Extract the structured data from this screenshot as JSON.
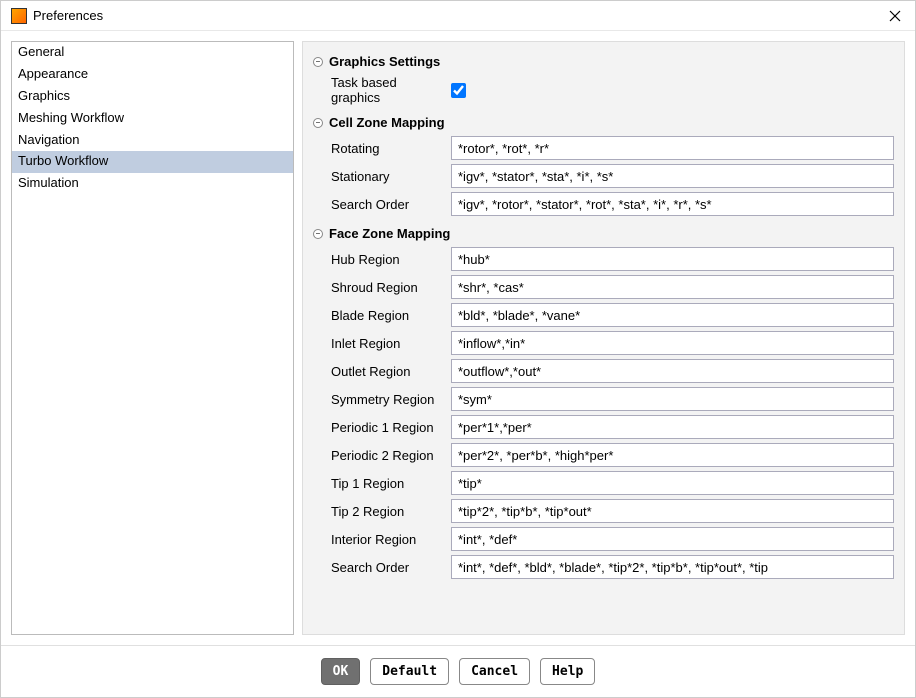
{
  "window": {
    "title": "Preferences"
  },
  "sidebar": {
    "items": [
      {
        "label": "General",
        "selected": false
      },
      {
        "label": "Appearance",
        "selected": false
      },
      {
        "label": "Graphics",
        "selected": false
      },
      {
        "label": "Meshing Workflow",
        "selected": false
      },
      {
        "label": "Navigation",
        "selected": false
      },
      {
        "label": "Turbo Workflow",
        "selected": true
      },
      {
        "label": "Simulation",
        "selected": false
      }
    ]
  },
  "sections": {
    "graphics": {
      "title": "Graphics Settings",
      "task_based_label": "Task based graphics",
      "task_based_checked": true
    },
    "cell_zone": {
      "title": "Cell Zone Mapping",
      "rotating_label": "Rotating",
      "rotating_value": "*rotor*, *rot*, *r*",
      "stationary_label": "Stationary",
      "stationary_value": "*igv*, *stator*, *sta*, *i*, *s*",
      "search_order_label": "Search Order",
      "search_order_value": "*igv*, *rotor*, *stator*, *rot*, *sta*, *i*, *r*, *s*"
    },
    "face_zone": {
      "title": "Face Zone Mapping",
      "hub_label": "Hub Region",
      "hub_value": "*hub*",
      "shroud_label": "Shroud Region",
      "shroud_value": "*shr*, *cas*",
      "blade_label": "Blade Region",
      "blade_value": "*bld*, *blade*, *vane*",
      "inlet_label": "Inlet Region",
      "inlet_value": "*inflow*,*in*",
      "outlet_label": "Outlet Region",
      "outlet_value": "*outflow*,*out*",
      "symmetry_label": "Symmetry Region",
      "symmetry_value": "*sym*",
      "periodic1_label": "Periodic 1 Region",
      "periodic1_value": "*per*1*,*per*",
      "periodic2_label": "Periodic 2 Region",
      "periodic2_value": "*per*2*, *per*b*, *high*per*",
      "tip1_label": "Tip 1 Region",
      "tip1_value": "*tip*",
      "tip2_label": "Tip 2 Region",
      "tip2_value": "*tip*2*, *tip*b*, *tip*out*",
      "interior_label": "Interior Region",
      "interior_value": "*int*, *def*",
      "search_order_label": "Search Order",
      "search_order_value": "*int*, *def*, *bld*, *blade*, *tip*2*, *tip*b*, *tip*out*, *tip"
    }
  },
  "footer": {
    "ok": "OK",
    "default": "Default",
    "cancel": "Cancel",
    "help": "Help"
  }
}
